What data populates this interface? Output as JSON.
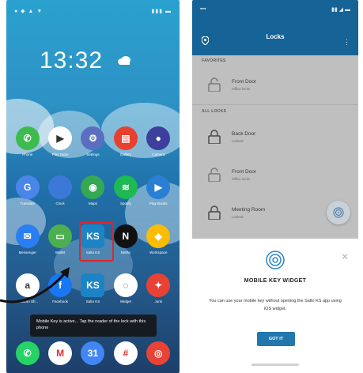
{
  "left_phone": {
    "clock": "13:32",
    "apps_row1": [
      {
        "label": "Phone",
        "icon": "phone-icon",
        "color": "#3dbb4e",
        "glyph": "✆"
      },
      {
        "label": "Play Store",
        "icon": "play-store-icon",
        "color": "#ffffff",
        "glyph": "▶"
      },
      {
        "label": "Settings",
        "icon": "settings-icon",
        "color": "#5a6fbf",
        "glyph": "⚙"
      },
      {
        "label": "Gallery",
        "icon": "gallery-icon",
        "color": "#e8402f",
        "glyph": "▤"
      },
      {
        "label": "Camera",
        "icon": "camera-icon",
        "color": "#3c3f9c",
        "glyph": "●"
      }
    ],
    "apps_row2": [
      {
        "label": "Translate",
        "icon": "translate-icon",
        "color": "#4a86e8",
        "glyph": "G"
      },
      {
        "label": "Clock",
        "icon": "clock-icon",
        "color": "#3c78d8",
        "glyph": ""
      },
      {
        "label": "Maps",
        "icon": "maps-icon",
        "color": "#34a853",
        "glyph": "◉"
      },
      {
        "label": "Spotify",
        "icon": "spotify-icon",
        "color": "#1db954",
        "glyph": "≋"
      },
      {
        "label": "Play Books",
        "icon": "play-books-icon",
        "color": "#2a7fd4",
        "glyph": "▶"
      }
    ],
    "apps_row3": [
      {
        "label": "Messenger",
        "icon": "messenger-icon",
        "color": "#2a7ef2",
        "glyph": "✉"
      },
      {
        "label": "Wallet",
        "icon": "wallet-icon",
        "color": "#4caf50",
        "glyph": "▭"
      },
      {
        "label": "Salto KS",
        "icon": "salto-ks-icon",
        "color": "#1c84c6",
        "glyph": "KS"
      },
      {
        "label": "Netflix",
        "icon": "netflix-icon",
        "color": "#111111",
        "glyph": "N"
      },
      {
        "label": "Workspace",
        "icon": "workspace-icon",
        "color": "#fbbc05",
        "glyph": "◆"
      }
    ],
    "apps_row4": [
      {
        "label": "Amazon Sh...",
        "icon": "amazon-icon",
        "color": "#ffffff",
        "glyph": "a"
      },
      {
        "label": "Facebook",
        "icon": "facebook-icon",
        "color": "#1877f2",
        "glyph": "f"
      },
      {
        "label": "Salto KS",
        "icon": "salto-ks-icon",
        "color": "#1c84c6",
        "glyph": "KS"
      },
      {
        "label": "Widget",
        "icon": "widget-icon",
        "color": "#ffffff",
        "glyph": "◌"
      },
      {
        "label": "Junk",
        "icon": "pinwheel-icon",
        "color": "#e94235",
        "glyph": "✦"
      }
    ],
    "toast_text": "Mobile Key is active... Tap the reader of the lock with this phone",
    "dock": [
      {
        "icon": "whatsapp-icon",
        "color": "#25d366",
        "glyph": "✆"
      },
      {
        "icon": "gmail-icon",
        "color": "#ffffff",
        "glyph": "M"
      },
      {
        "icon": "calendar-icon",
        "color": "#4285f4",
        "glyph": "31"
      },
      {
        "icon": "slack-icon",
        "color": "#ffffff",
        "glyph": "#"
      },
      {
        "icon": "chrome-icon",
        "color": "#ea4335",
        "glyph": "◎"
      }
    ]
  },
  "right_phone": {
    "app_title": "Locks",
    "sections": {
      "favorites": "FAVORITES",
      "all_locks": "ALL LOCKS"
    },
    "doors": [
      {
        "name": "Front Door",
        "sub": "Office locks"
      },
      {
        "name": "Back Door",
        "sub": "Locked"
      },
      {
        "name": "Front Door",
        "sub": "Office locks"
      },
      {
        "name": "Meeting Room",
        "sub": "Locked"
      }
    ],
    "sheet": {
      "title": "MOBILE KEY WIDGET",
      "body": "You can use your mobile key without opening the Salto KS app using iOS widget.",
      "button": "GOT IT"
    }
  },
  "colors": {
    "app_bar": "#166397",
    "highlight": "#e0262a",
    "button": "#2277ad"
  }
}
